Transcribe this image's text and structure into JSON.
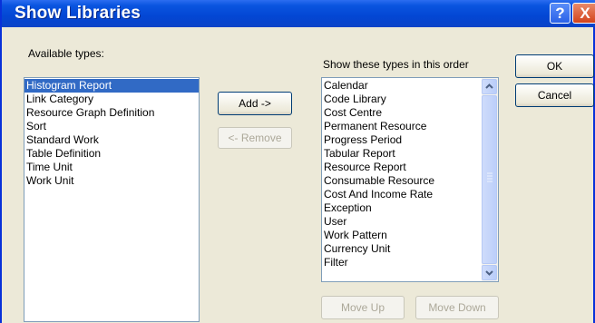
{
  "window": {
    "title": "Show Libraries",
    "help_label": "?",
    "close_label": "X"
  },
  "available": {
    "label": "Available types:",
    "items": [
      "Histogram Report",
      "Link Category",
      "Resource Graph Definition",
      "Sort",
      "Standard Work",
      "Table Definition",
      "Time Unit",
      "Work Unit"
    ],
    "selected_index": 0
  },
  "buttons": {
    "add": "Add ->",
    "remove": "<- Remove",
    "ok": "OK",
    "cancel": "Cancel",
    "move_up": "Move Up",
    "move_down": "Move Down"
  },
  "shown": {
    "label": "Show these types in this order",
    "items": [
      "Calendar",
      "Code Library",
      "Cost Centre",
      "Permanent Resource",
      "Progress Period",
      "Tabular Report",
      "Resource Report",
      "Consumable Resource",
      "Cost And Income Rate",
      "Exception",
      "User",
      "Work Pattern",
      "Currency Unit",
      "Filter"
    ]
  },
  "icons": {
    "scroll_up": "scroll-up-arrow-icon",
    "scroll_down": "scroll-down-arrow-icon",
    "scroll_grip": "scroll-grip-icon"
  },
  "colors": {
    "title_bar": "#0a55e0",
    "selection": "#316ac5",
    "dialog_bg": "#ece9d8"
  }
}
